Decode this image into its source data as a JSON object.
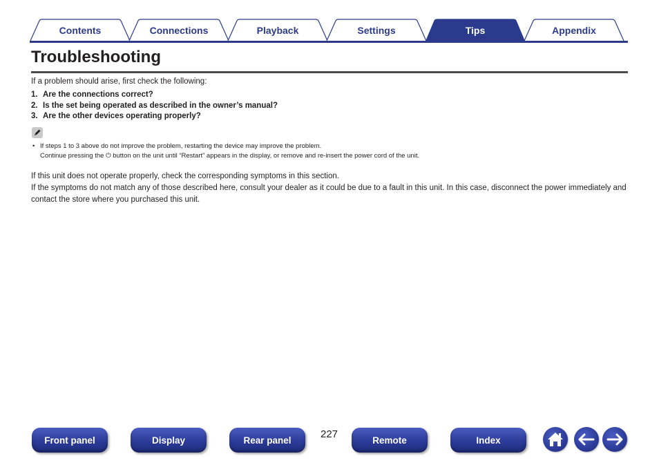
{
  "tabs": [
    {
      "label": "Contents",
      "active": false
    },
    {
      "label": "Connections",
      "active": false
    },
    {
      "label": "Playback",
      "active": false
    },
    {
      "label": "Settings",
      "active": false
    },
    {
      "label": "Tips",
      "active": true
    },
    {
      "label": "Appendix",
      "active": false
    }
  ],
  "colors": {
    "accent": "#2b3a8c",
    "tab_active_bg": "#2b3a8c",
    "title_rule": "#4a4a4a"
  },
  "page": {
    "title": "Troubleshooting",
    "intro": "If a problem should arise, first check the following:",
    "checklist": [
      {
        "num": "1.",
        "text": "Are the connections correct?"
      },
      {
        "num": "2.",
        "text": "Is the set being operated as described in the owner’s manual?"
      },
      {
        "num": "3.",
        "text": "Are the other devices operating properly?"
      }
    ],
    "note_icon": "pencil-icon",
    "note": {
      "bullet": "•",
      "line1": "If steps 1 to 3 above do not improve the problem, restarting the device may improve the problem.",
      "line2_before": "Continue pressing the ",
      "power_symbol": "⏻",
      "line2_after": " button on the unit until “Restart” appears in the display, or remove and re-insert the power cord of the unit."
    },
    "paragraph1": "If this unit does not operate properly, check the corresponding symptoms in this section.",
    "paragraph2": "If the symptoms do not match any of those described here, consult your dealer as it could be due to a fault in this unit. In this case, disconnect the power immediately and contact the store where you purchased this unit."
  },
  "footer": {
    "buttons": [
      "Front panel",
      "Display",
      "Rear panel",
      "Remote",
      "Index"
    ],
    "page_number": "227",
    "icons": [
      "home-icon",
      "arrow-left-icon",
      "arrow-right-icon"
    ]
  }
}
